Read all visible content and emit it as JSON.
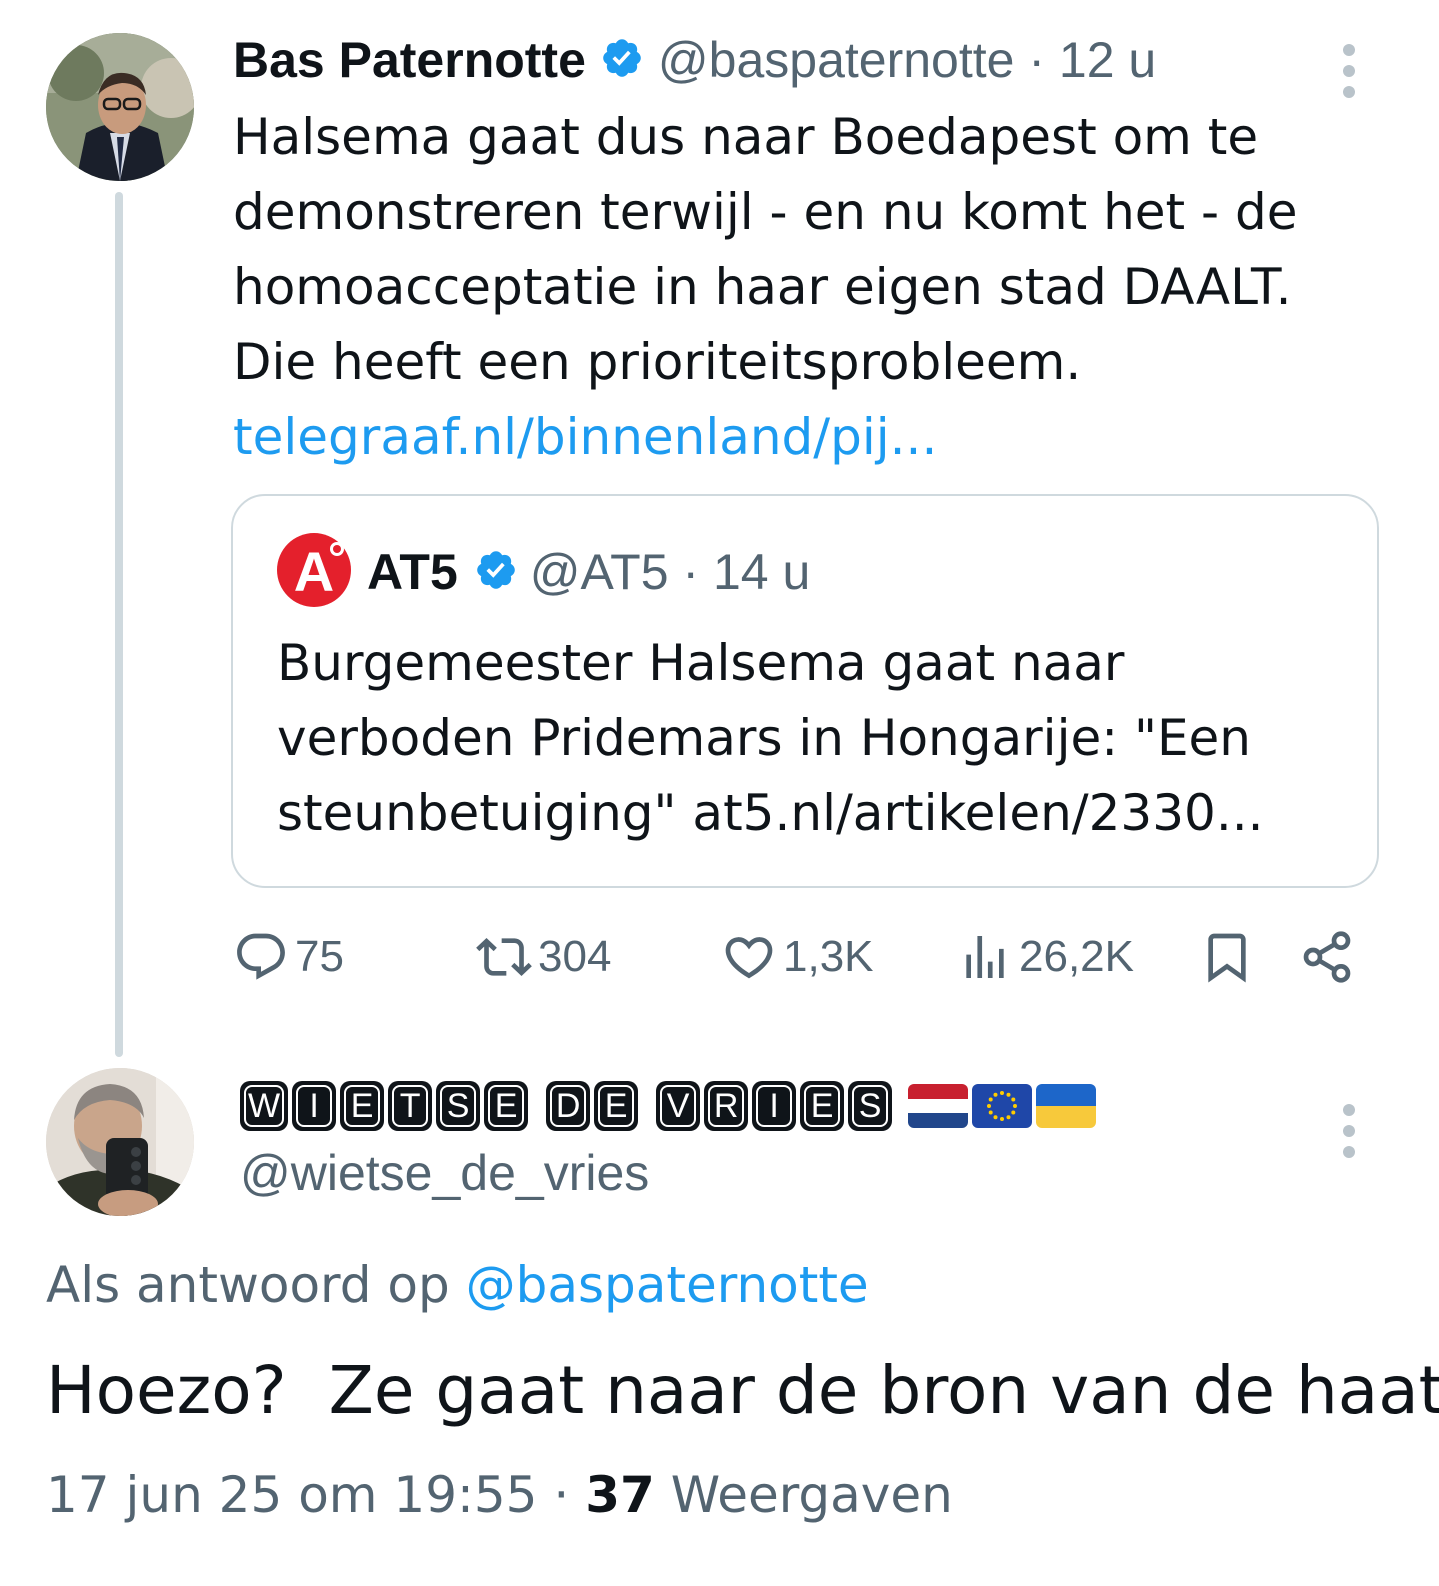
{
  "parent_tweet": {
    "author_name": "Bas Paternotte",
    "author_handle": "@baspaternotte",
    "time": "· 12 u",
    "text_lines": [
      "Halsema gaat dus naar Boedapest om te",
      "demonstreren terwijl - en nu komt het - de",
      "homoacceptatie in haar eigen stad DAALT.",
      "Die heeft een prioriteitsprobleem."
    ],
    "link": "telegraaf.nl/binnenland/pij...",
    "quoted": {
      "logo_letter": "A",
      "author_name": "AT5",
      "author_handle": "@AT5",
      "time": "· 14 u",
      "text_lines": [
        "Burgemeester Halsema gaat naar",
        "verboden Pridemars in Hongarije: \"Een",
        "steunbetuiging\" at5.nl/artikelen/2330..."
      ]
    },
    "stats": {
      "replies": "75",
      "retweets": "304",
      "likes": "1,3K",
      "views": "26,2K"
    }
  },
  "reply_tweet": {
    "author_name_letters": [
      "W",
      "I",
      "E",
      "T",
      "S",
      "E",
      " ",
      "D",
      "E",
      " ",
      "V",
      "R",
      "I",
      "E",
      "S"
    ],
    "flags": [
      "netherlands-flag",
      "eu-flag",
      "ukraine-flag"
    ],
    "author_handle": "@wietse_de_vries",
    "reply_prefix": "Als antwoord op",
    "reply_mention": "@baspaternotte",
    "text": "Hoezo?  Ze gaat naar de bron van de haat.",
    "timestamp": "17 jun 25 om 19:55",
    "separator": "·",
    "view_count": "37",
    "view_label": "Weergaven"
  },
  "icons": [
    "reply-icon",
    "retweet-icon",
    "like-icon",
    "views-icon",
    "bookmark-icon",
    "share-icon",
    "verified-badge-icon",
    "more-icon"
  ],
  "colors": {
    "text": "#0f1419",
    "secondary": "#536471",
    "link": "#1d9bf0",
    "border": "#cfd9de",
    "verified": "#1d9bf0",
    "at5_red": "#e4202c"
  }
}
